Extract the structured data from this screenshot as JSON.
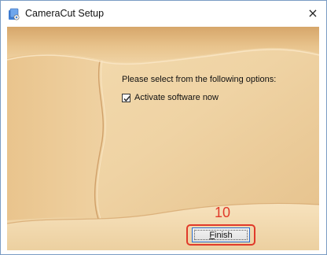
{
  "window": {
    "title": "CameraCut Setup",
    "close_glyph": "×"
  },
  "content": {
    "options_prompt": "Please select from the following options:",
    "activate_checkbox": {
      "label": "Activate software now",
      "checked": true
    }
  },
  "annotation": {
    "step_number": "10",
    "color": "#e03a2a"
  },
  "footer": {
    "finish_accel": "F",
    "finish_rest": "inish"
  },
  "colors": {
    "sand_light": "#f6e2bd",
    "sand_mid": "#efd4a6",
    "sand_dark": "#d9ab6c",
    "focus_border": "#2b6fd0"
  },
  "icons": {
    "app": "installer-icon",
    "close": "close-icon",
    "check": "checkmark-icon"
  }
}
